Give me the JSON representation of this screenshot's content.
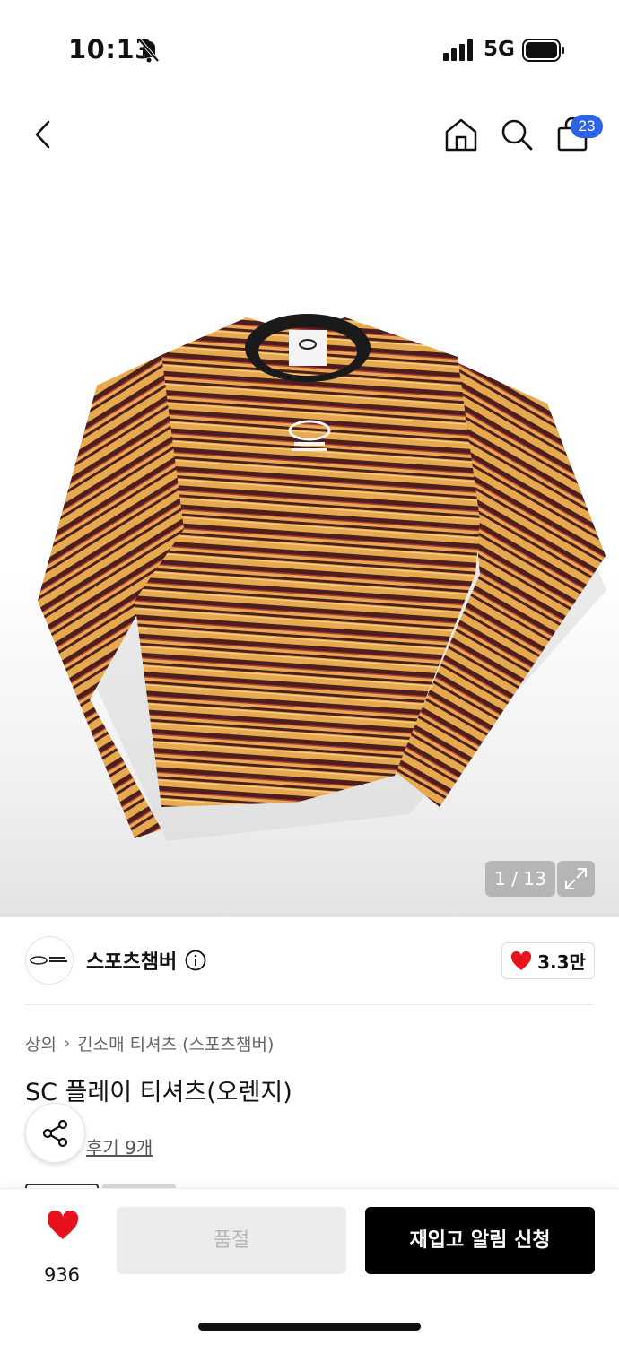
{
  "status_bar": {
    "time": "10:13",
    "network": "5G",
    "icons": [
      "bell-off-icon",
      "signal-icon",
      "battery-icon"
    ]
  },
  "nav": {
    "icons": [
      "back-arrow-icon",
      "home-icon",
      "search-icon",
      "shopping-bag-icon"
    ],
    "cart_count": "23"
  },
  "gallery": {
    "image": "orange and burgundy striped long sleeve t-shirt",
    "counter": "1 / 13",
    "expand_icon": "expand-icon"
  },
  "brand": {
    "name": "스포츠챔버",
    "logo": "sport-chamber-logo",
    "info_icon": "info-icon",
    "likes": "3.3만"
  },
  "product": {
    "breadcrumb": [
      "상의",
      "긴소매 티셔츠 (스포츠챔버)"
    ],
    "title": "SC 플레이 티셔츠(오렌지)",
    "reviews": "후기 9개"
  },
  "actions": {
    "wish_count": "936",
    "soldout_label": "품절",
    "restock_label": "재입고 알림 신청"
  },
  "colors": {
    "accent_badge": "#2d63e8",
    "heart": "#e8121d",
    "primary_button": "#000000",
    "disabled_button": "#ececec"
  }
}
